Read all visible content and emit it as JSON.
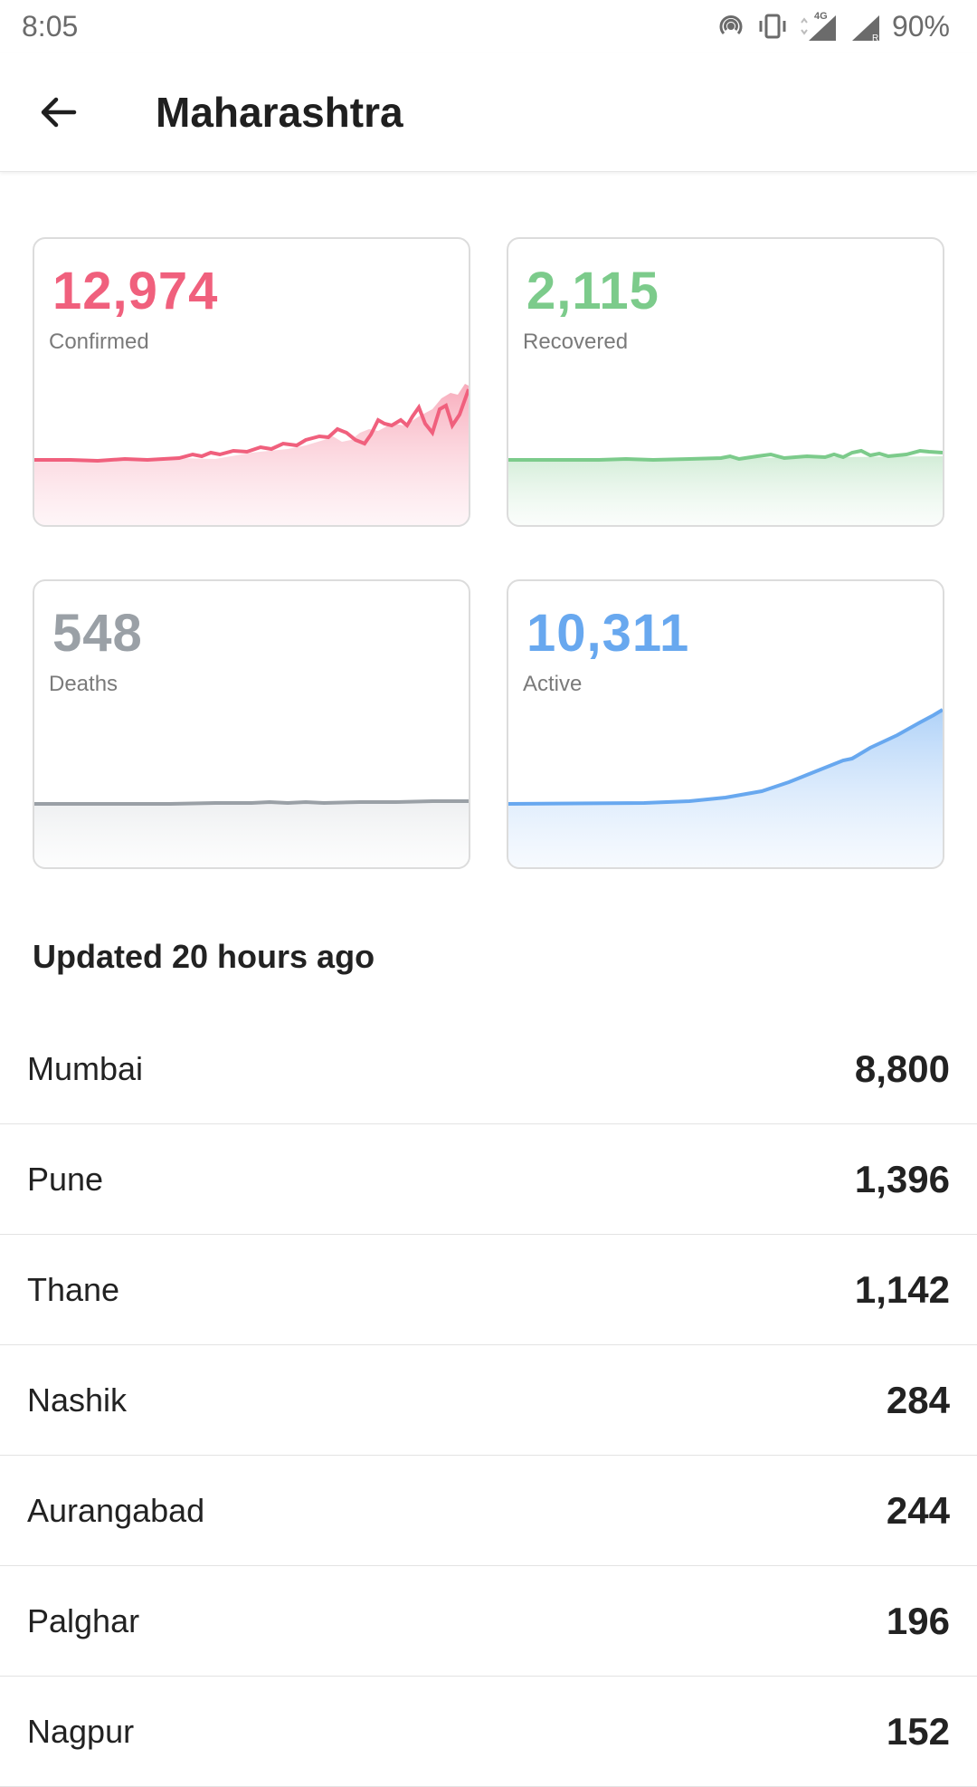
{
  "status_bar": {
    "time": "8:05",
    "battery": "90%",
    "network": "4G"
  },
  "app_bar": {
    "title": "Maharashtra"
  },
  "colors": {
    "confirmed": "#f0607d",
    "recovered": "#7ccb8b",
    "deaths": "#9aa0a6",
    "active": "#68a8ef"
  },
  "stats": [
    {
      "value": "12,974",
      "label": "Confirmed"
    },
    {
      "value": "2,115",
      "label": "Recovered"
    },
    {
      "value": "548",
      "label": "Deaths"
    },
    {
      "value": "10,311",
      "label": "Active"
    }
  ],
  "updated_text": "Updated 20 hours ago",
  "districts": [
    {
      "name": "Mumbai",
      "count": "8,800"
    },
    {
      "name": "Pune",
      "count": "1,396"
    },
    {
      "name": "Thane",
      "count": "1,142"
    },
    {
      "name": "Nashik",
      "count": "284"
    },
    {
      "name": "Aurangabad",
      "count": "244"
    },
    {
      "name": "Palghar",
      "count": "196"
    },
    {
      "name": "Nagpur",
      "count": "152"
    }
  ]
}
